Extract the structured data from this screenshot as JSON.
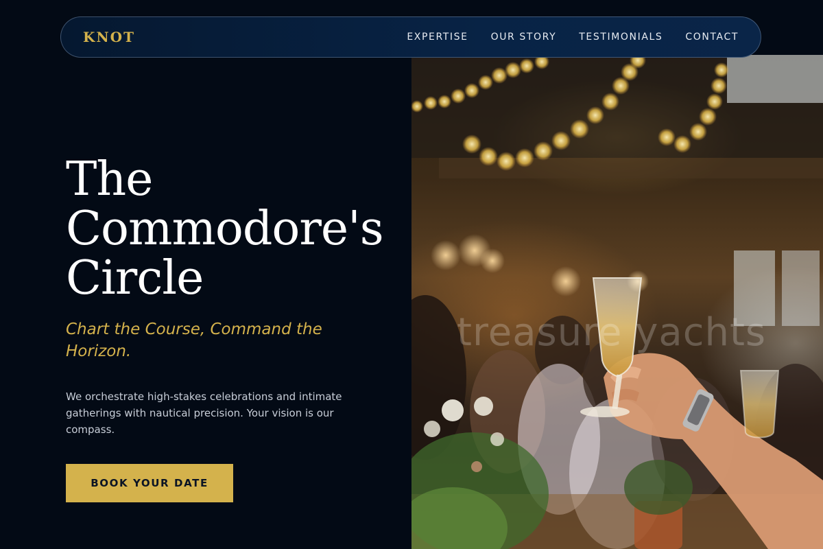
{
  "nav": {
    "brand": "KNOT",
    "links": [
      {
        "label": "EXPERTISE"
      },
      {
        "label": "OUR STORY"
      },
      {
        "label": "TESTIMONIALS"
      },
      {
        "label": "CONTACT"
      }
    ]
  },
  "hero": {
    "title_lines": [
      "The",
      "Commodore's",
      "Circle"
    ],
    "tagline": "Chart the Course, Command the Horizon.",
    "description": "We orchestrate high-stakes celebrations and intimate gatherings with nautical precision. Your vision is our compass.",
    "cta_label": "BOOK YOUR DATE",
    "image_watermark": "treasure yachts"
  },
  "colors": {
    "background": "#030a15",
    "nav_background": "#082345",
    "accent_gold": "#d4b24c",
    "text_light": "#ffffff",
    "text_muted": "#c8ced8"
  }
}
